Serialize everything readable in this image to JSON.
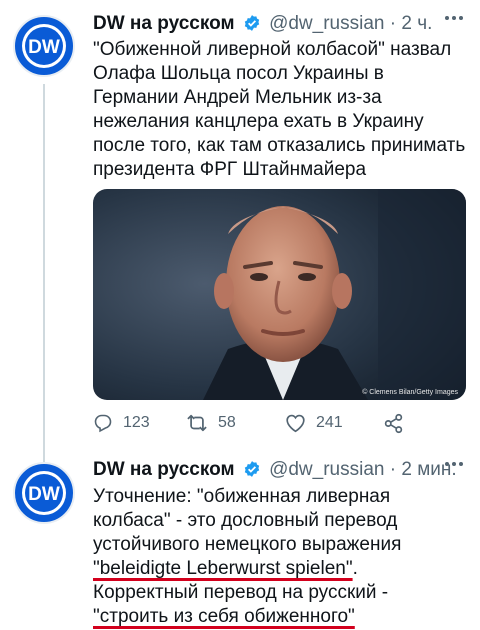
{
  "tweets": [
    {
      "avatar_text": "DW",
      "author_name": "DW на русском",
      "handle": "@dw_russian",
      "separator": "·",
      "time": "2 ч.",
      "text": "\"Обиженной ливерной колбасой\" назвал Олафа Шольца посол Украины в Германии Андрей Мельник из-за нежелания канцлера ехать в Украину после того, как там отказались принимать президента ФРГ Штайнмайера",
      "photo_credit": "© Clemens Bilan/Getty Images",
      "replies": "123",
      "retweets": "58",
      "likes": "241"
    },
    {
      "avatar_text": "DW",
      "author_name": "DW на русском",
      "handle": "@dw_russian",
      "separator": "·",
      "time": "2 мин.",
      "text_part1": "Уточнение: \"обиженная ливерная колбаса\" - это дословный перевод устойчивого немецкого выражения ",
      "text_highlight1": "\"beleidigte Leberwurst spielen\"",
      "text_part2": ". Корректный перевод на русский - ",
      "text_highlight2": "\"строить из себя обиженного\"",
      "text_part3": ""
    }
  ],
  "colors": {
    "brand_blue": "#0a5bd6",
    "verified_blue": "#1d9bf0",
    "muted_text": "#536471",
    "highlight_red": "#d3001d"
  }
}
